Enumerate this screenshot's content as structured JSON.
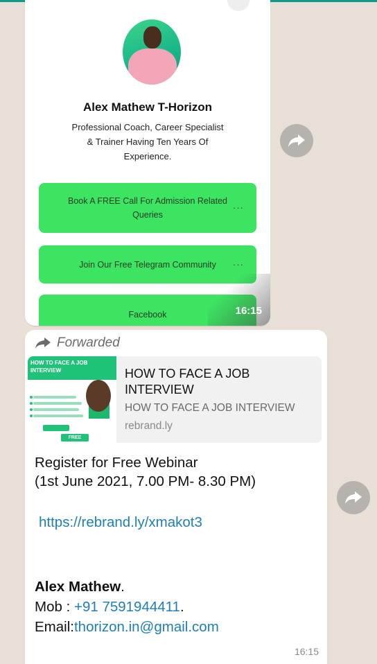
{
  "card": {
    "name": "Alex Mathew T-Horizon",
    "bio": "Professional Coach, Career Specialist & Trainer Having Ten Years Of Experience.",
    "buttons": [
      {
        "label": "Book A FREE Call For Admission Related Queries",
        "menu": "···"
      },
      {
        "label": "Join Our Free Telegram Community",
        "menu": "···"
      },
      {
        "label": "Facebook"
      }
    ],
    "time": "16:15"
  },
  "message": {
    "forwarded_label": "Forwarded",
    "preview": {
      "thumb_heading": "HOW TO FACE A JOB INTERVIEW",
      "thumb_badge": "FREE",
      "title": "HOW TO FACE A JOB INTERVIEW",
      "description": "HOW TO FACE A JOB INTERVIEW",
      "domain": "rebrand.ly"
    },
    "body_line1": "Register for Free Webinar",
    "body_line2": "(1st June 2021, 7.00 PM- 8.30 PM)",
    "link": "https://rebrand.ly/xmakot3",
    "contact_name": "Alex Mathew",
    "contact_name_suffix": ".",
    "mob_label": "Mob : ",
    "mob_number": "+91 7591944411",
    "mob_suffix": ".",
    "email_label": "Email:",
    "email": "thorizon.in@gmail.com",
    "time": "16:15"
  },
  "colors": {
    "button_green": "#3ce462",
    "link_blue": "#1d7fb5",
    "wallpaper": "#e8e0d6"
  }
}
